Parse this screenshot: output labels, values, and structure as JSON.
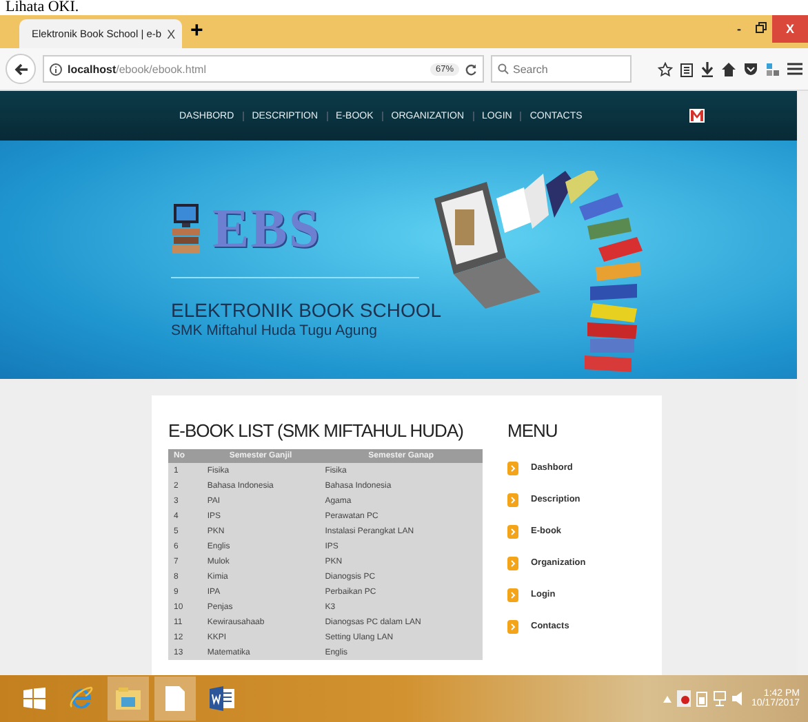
{
  "caption": "Lihata OKI.",
  "browser": {
    "tab": {
      "title": "Elektronik Book School | e-b",
      "close": "X"
    },
    "new_tab": "+",
    "window_controls": [
      "-",
      "X"
    ],
    "url": "**localhost**/ebook/ebook.html",
    "zoom": "67%",
    "search": {
      "placeholder": "Search"
    }
  },
  "nav": [
    "DASHBORD",
    "DESCRIPTION",
    "E-BOOK",
    "ORGANIZATION",
    "LOGIN",
    "CONTACTS"
  ],
  "banner": {
    "logo": "EBS",
    "title": "ELEKTRONIK BOOK SCHOOL",
    "subtitle": "SMK Miftahul Huda Tugu Agung"
  },
  "list": {
    "title": "E-BOOK LIST (SMK MIFTAHUL HUDA)",
    "columns": [
      "No",
      "Semester Ganjil",
      "Semester Ganap"
    ],
    "rows": [
      [
        "1",
        "Fisika",
        "Fisika"
      ],
      [
        "2",
        "Bahasa Indonesia",
        "Bahasa Indonesia"
      ],
      [
        "3",
        "PAI",
        "Agama"
      ],
      [
        "4",
        "IPS",
        "Perawatan PC"
      ],
      [
        "5",
        "PKN",
        "Instalasi Perangkat LAN"
      ],
      [
        "6",
        "Englis",
        "IPS"
      ],
      [
        "7",
        "Mulok",
        "PKN"
      ],
      [
        "8",
        "Kimia",
        "Dianogsis PC"
      ],
      [
        "9",
        "IPA",
        "Perbaikan PC"
      ],
      [
        "10",
        "Penjas",
        "K3"
      ],
      [
        "11",
        "Kewirausahaab",
        "Dianogsas PC dalam LAN"
      ],
      [
        "12",
        "KKPI",
        "Setting Ulang LAN"
      ],
      [
        "13",
        "Matematika",
        "Englis"
      ]
    ]
  },
  "menu": {
    "title": "MENU",
    "items": [
      "Dashbord",
      "Description",
      "E-book",
      "Organization",
      "Login",
      "Contacts"
    ]
  },
  "taskbar": {
    "time": "1:42 PM",
    "date": "10/17/2017"
  }
}
